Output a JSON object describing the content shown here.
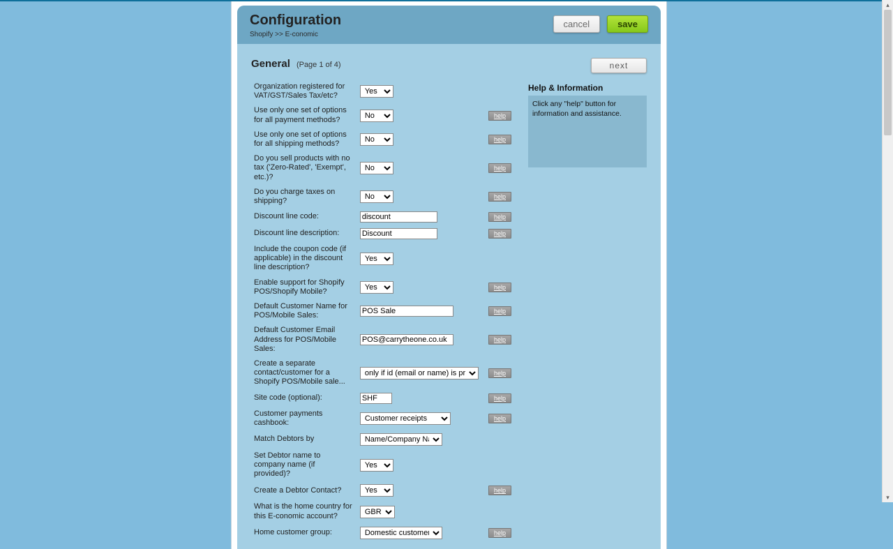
{
  "header": {
    "title": "Configuration",
    "breadcrumb": "Shopify >> E-conomic",
    "cancel": "cancel",
    "save": "save"
  },
  "section": {
    "title": "General",
    "pager": "(Page 1 of 4)",
    "next": "next"
  },
  "helpPanel": {
    "title": "Help & Information",
    "body": "Click any \"help\" button for information and assistance."
  },
  "helpLabel": "help",
  "optionsYesNo": [
    "Yes",
    "No"
  ],
  "fields": {
    "vat": {
      "label": "Organization registered for VAT/GST/Sales Tax/etc?",
      "value": "Yes",
      "help": false
    },
    "onePayment": {
      "label": "Use only one set of options for all payment methods?",
      "value": "No",
      "help": true
    },
    "oneShipping": {
      "label": "Use only one set of options for all shipping methods?",
      "value": "No",
      "help": true
    },
    "zeroRated": {
      "label": "Do you sell products with no tax ('Zero-Rated', 'Exempt', etc.)?",
      "value": "No",
      "help": true
    },
    "taxShipping": {
      "label": "Do you charge taxes on shipping?",
      "value": "No",
      "help": true
    },
    "discCode": {
      "label": "Discount line code:",
      "value": "discount",
      "help": true
    },
    "discDesc": {
      "label": "Discount line description:",
      "value": "Discount",
      "help": true
    },
    "coupon": {
      "label": "Include the coupon code (if applicable) in the discount line description?",
      "value": "Yes",
      "help": false
    },
    "pos": {
      "label": "Enable support for Shopify POS/Shopify Mobile?",
      "value": "Yes",
      "help": true
    },
    "posName": {
      "label": "Default Customer Name for POS/Mobile Sales:",
      "value": "POS Sale",
      "help": true
    },
    "posEmail": {
      "label": "Default Customer Email Address for POS/Mobile Sales:",
      "value": "POS@carrytheone.co.uk",
      "help": true
    },
    "posContact": {
      "label": "Create a separate contact/customer for a Shopify POS/Mobile sale...",
      "value": "only if id (email or name) is provided",
      "help": true
    },
    "siteCode": {
      "label": "Site code (optional):",
      "value": "SHF",
      "help": true
    },
    "cashbook": {
      "label": "Customer payments cashbook:",
      "value": "Customer receipts",
      "help": true
    },
    "matchDebtor": {
      "label": "Match Debtors by",
      "value": "Name/Company Name",
      "help": false
    },
    "debtorCompany": {
      "label": "Set Debtor name to company name (if provided)?",
      "value": "Yes",
      "help": false
    },
    "debtorContact": {
      "label": "Create a Debtor Contact?",
      "value": "Yes",
      "help": true
    },
    "homeCountry": {
      "label": "What is the home country for this E-conomic account?",
      "value": "GBR",
      "help": false
    },
    "homeGroup": {
      "label": "Home customer group:",
      "value": "Domestic customers",
      "help": true
    }
  }
}
